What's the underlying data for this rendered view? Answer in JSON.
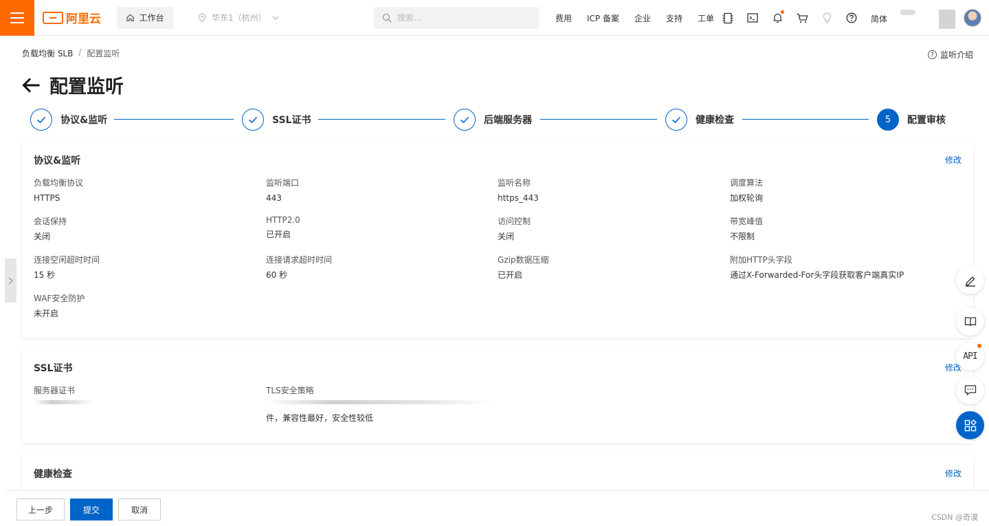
{
  "topbar": {
    "logo_text": "阿里云",
    "workbench": "工作台",
    "region": "华东1（杭州）",
    "search_placeholder": "搜索...",
    "nav": [
      "费用",
      "ICP 备案",
      "企业",
      "支持",
      "工单"
    ],
    "lang": "简体",
    "accent_color": "#ff6a00"
  },
  "breadcrumb": {
    "root": "负载均衡 SLB",
    "separator": "/",
    "current": "配置监听"
  },
  "help_link": "监听介绍",
  "page_title": "配置监听",
  "steps": [
    {
      "label": "协议&监听",
      "state": "done"
    },
    {
      "label": "SSL证书",
      "state": "done"
    },
    {
      "label": "后端服务器",
      "state": "done"
    },
    {
      "label": "健康检查",
      "state": "done"
    },
    {
      "label": "配置审核",
      "state": "active",
      "number": "5"
    }
  ],
  "sections": {
    "protocol": {
      "title": "协议&监听",
      "edit": "修改",
      "fields": [
        {
          "label": "负载均衡协议",
          "value": "HTTPS"
        },
        {
          "label": "监听端口",
          "value": "443"
        },
        {
          "label": "监听名称",
          "value": "https_443"
        },
        {
          "label": "调度算法",
          "value": "加权轮询"
        },
        {
          "label": "会话保持",
          "value": "关闭"
        },
        {
          "label": "HTTP2.0",
          "value": "已开启"
        },
        {
          "label": "访问控制",
          "value": "关闭"
        },
        {
          "label": "带宽峰值",
          "value": "不限制"
        },
        {
          "label": "连接空闲超时时间",
          "value": "15 秒"
        },
        {
          "label": "连接请求超时时间",
          "value": "60 秒"
        },
        {
          "label": "Gzip数据压缩",
          "value": "已开启"
        },
        {
          "label": "附加HTTP头字段",
          "value": "通过X-Forwarded-For头字段获取客户端真实IP"
        },
        {
          "label": "WAF安全防护",
          "value": "未开启"
        }
      ]
    },
    "ssl": {
      "title": "SSL证书",
      "edit": "修改",
      "server_cert_label": "服务器证书",
      "tls_label": "TLS安全策略",
      "tls_value_line2": "件，兼容性最好，安全性较低"
    },
    "health": {
      "title": "健康检查",
      "edit": "修改"
    }
  },
  "footer": {
    "prev": "上一步",
    "submit": "提交",
    "cancel": "取消",
    "watermark": "CSDN @奇漠"
  },
  "colors": {
    "primary": "#0064c8",
    "brand": "#ff6a00"
  }
}
